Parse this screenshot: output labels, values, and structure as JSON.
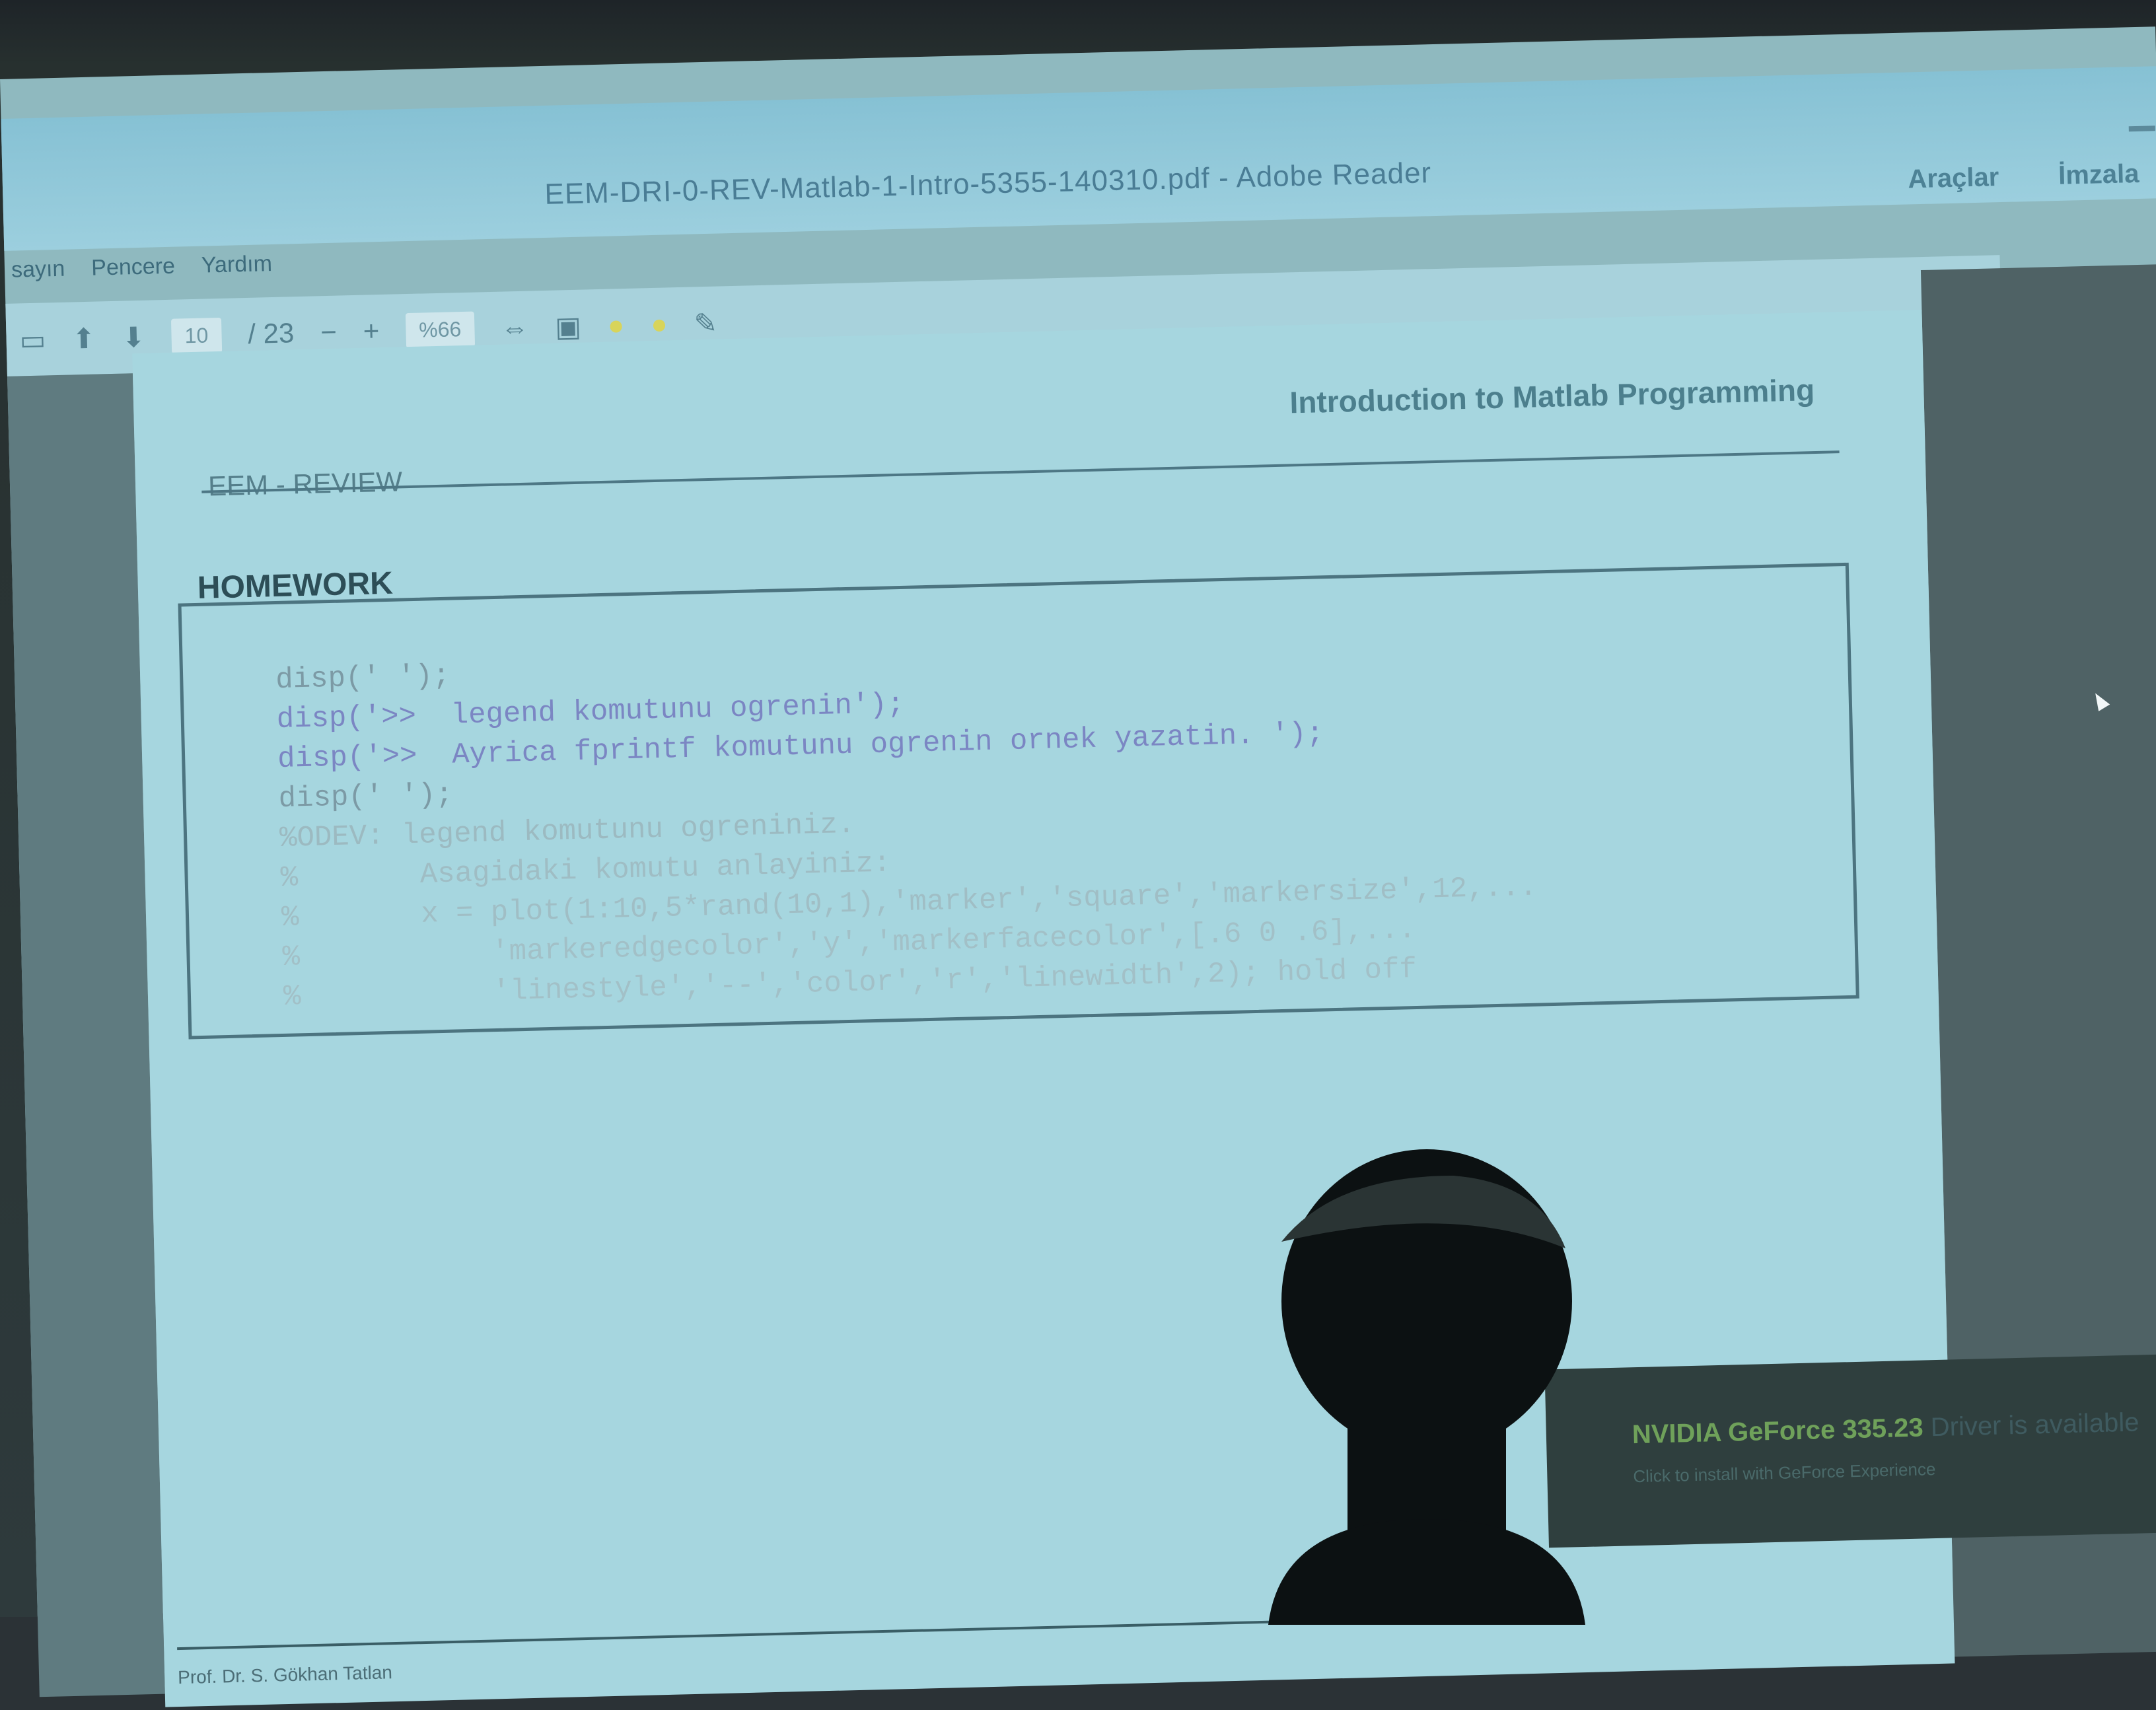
{
  "window": {
    "title": "EEM-DRI-0-REV-Matlab-1-Intro-5355-140310.pdf - Adobe Reader"
  },
  "top_right_tools": [
    "Araçlar",
    "İmzala"
  ],
  "menubar": {
    "items": [
      "sayın",
      "Pencere",
      "Yardım"
    ]
  },
  "toolbar": {
    "page_current": "10",
    "page_total": "/ 23",
    "zoom": "%66"
  },
  "page": {
    "header_right": "Introduction to Matlab Programming",
    "header_left": "EEM - REVIEW",
    "section_title": "HOMEWORK",
    "code_lines": [
      "disp(' ');",
      "disp('>>  legend komutunu ogrenin');",
      "disp('>>  Ayrica fprintf komutunu ogrenin ornek yazatin. ');",
      "disp(' ');",
      "%ODEV: legend komutunu ogreniniz.",
      "%       Asagidaki komutu anlayiniz:",
      "%       x = plot(1:10,5*rand(10,1),'marker','square','markersize',12,...",
      "%           'markeredgecolor','y','markerfacecolor',[.6 0 .6],...",
      "%           'linestyle','--','color','r','linewidth',2); hold off"
    ],
    "footer": "Prof. Dr. S. Gökhan Tatlan"
  },
  "notification": {
    "title": "NVIDIA GeForce 335.23",
    "title_rest": "Driver is available",
    "subtitle": "Click to install with GeForce Experience"
  },
  "colors": {
    "projection_bg": "#8fb9bf",
    "page_bg": "#a6d6df",
    "titlebar": "#86c1d4",
    "notification_green": "#6fa15a"
  }
}
